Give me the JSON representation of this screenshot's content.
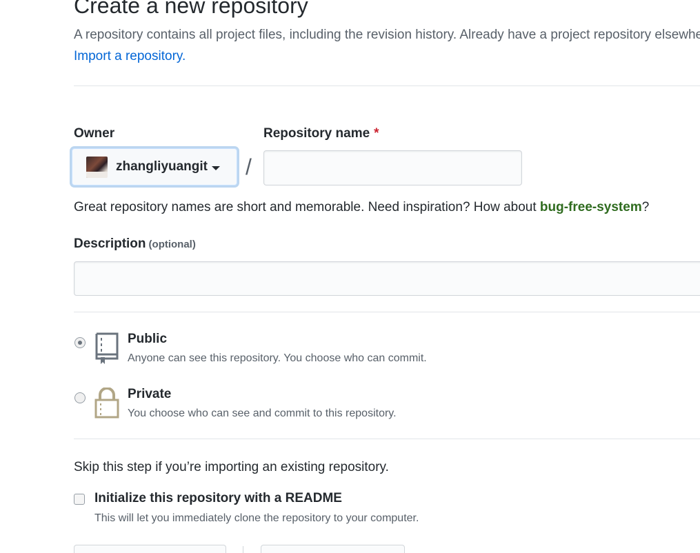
{
  "header": {
    "title": "Create a new repository",
    "subtitle": "A repository contains all project files, including the revision history. Already have a project repository elsewhere?",
    "import_link": "Import a repository."
  },
  "form": {
    "owner_label": "Owner",
    "owner_value": "zhangliyuangit",
    "repo_name_label": "Repository name",
    "required_marker": "*",
    "slash": "/",
    "repo_name_value": "",
    "hint_text": "Great repository names are short and memorable. Need inspiration? How about ",
    "hint_suggestion": "bug-free-system",
    "hint_end": "?",
    "description_label": "Description",
    "description_optional": "(optional)",
    "description_value": ""
  },
  "visibility": {
    "selected": "public",
    "options": [
      {
        "title": "Public",
        "description": "Anyone can see this repository. You choose who can commit."
      },
      {
        "title": "Private",
        "description": "You choose who can see and commit to this repository."
      }
    ]
  },
  "init": {
    "skip_text": "Skip this step if you’re importing an existing repository.",
    "readme_title": "Initialize this repository with a README",
    "readme_description": "This will let you immediately clone the repository to your computer.",
    "readme_checked": false
  },
  "colors": {
    "link": "#0366d6",
    "required": "#cb2431",
    "suggestion": "#2f6b1f",
    "icon": "#6a737d",
    "lock": "#b1a686"
  },
  "icons": {
    "public": "repo-icon",
    "private": "lock-icon",
    "owner_caret": "caret-down-icon"
  }
}
